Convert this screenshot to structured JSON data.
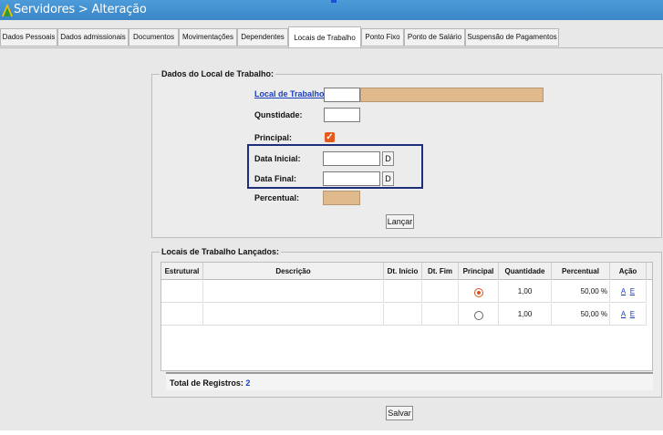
{
  "window": {
    "title": "Servidores > Alteração"
  },
  "tabs": [
    {
      "label": "Dados Pessoais"
    },
    {
      "label": "Dados admissionais"
    },
    {
      "label": "Documentos"
    },
    {
      "label": "Movimentações"
    },
    {
      "label": "Dependentes"
    },
    {
      "label": "Locais de Trabalho",
      "active": true
    },
    {
      "label": "Ponto Fixo"
    },
    {
      "label": "Ponto de Salário"
    },
    {
      "label": "Suspensão de Pagamentos"
    }
  ],
  "form": {
    "legend": "Dados do Local de Trabalho:",
    "local_label": "Local de Trabalho:",
    "local_code": "",
    "local_desc": "",
    "quantidade_label": "Qunstidade:",
    "quantidade_value": "",
    "principal_label": "Principal:",
    "principal_checked": true,
    "data_inicial_label": "Data Inicial:",
    "data_inicial_value": "",
    "data_final_label": "Data Final:",
    "data_final_value": "",
    "date_btn": "D",
    "percentual_label": "Percentual:",
    "percentual_value": "",
    "lancar_label": "Lançar"
  },
  "list": {
    "legend": "Locais de Trabalho Lançados:",
    "columns": [
      "Estrutural",
      "Descrição",
      "Dt. Início",
      "Dt. Fim",
      "Principal",
      "Quantidade",
      "Percentual",
      "Ação"
    ],
    "rows": [
      {
        "estrutural": "",
        "descricao": "",
        "dt_inicio": "",
        "dt_fim": "",
        "principal": true,
        "quantidade": "1,00",
        "percentual": "50,00 %",
        "acao_a": "A",
        "acao_e": "E"
      },
      {
        "estrutural": "",
        "descricao": "",
        "dt_inicio": "",
        "dt_fim": "",
        "principal": false,
        "quantidade": "1,00",
        "percentual": "50,00 %",
        "acao_a": "A",
        "acao_e": "E"
      }
    ],
    "total_label": "Total de Registros:",
    "total_value": "2"
  },
  "salvar_label": "Salvar",
  "colors": {
    "title_bar": "#3a86c7",
    "accent_orange": "#e35a1f",
    "tan_field": "#e0b98c",
    "link": "#1a3fbf",
    "highlight_box": "#1d2f7a"
  }
}
